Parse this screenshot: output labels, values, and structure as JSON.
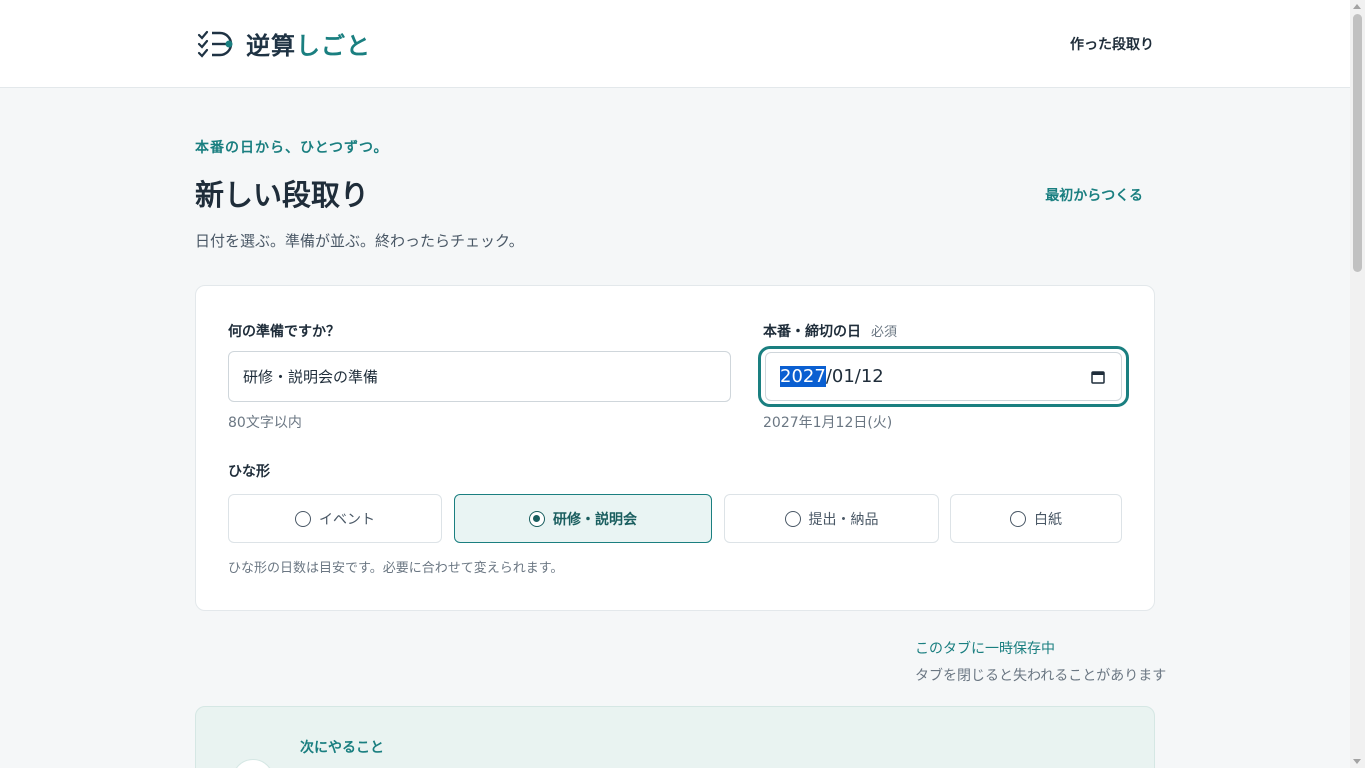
{
  "header": {
    "logo_text_dark": "逆算",
    "logo_text_teal": "しごと",
    "nav_link": "作った段取り"
  },
  "intro": {
    "eyebrow": "本番の日から、ひとつずつ。",
    "title": "新しい段取り",
    "restart_link": "最初からつくる",
    "subtitle": "日付を選ぶ。準備が並ぶ。終わったらチェック。"
  },
  "form": {
    "task_label": "何の準備ですか？",
    "task_value": "研修・説明会の準備",
    "task_hint": "80文字以内",
    "date_label": "本番・締切の日",
    "date_required": "必須",
    "date_year": "2027",
    "date_rest": "/01/12",
    "date_display": "2027年1月12日(火)",
    "template_label": "ひな形",
    "templates": [
      {
        "label": "イベント",
        "selected": false
      },
      {
        "label": "研修・説明会",
        "selected": true
      },
      {
        "label": "提出・納品",
        "selected": false
      },
      {
        "label": "白紙",
        "selected": false
      }
    ],
    "template_hint": "ひな形の日数は目安です。必要に合わせて変えられます。"
  },
  "save": {
    "status": "このタブに一時保存中",
    "note": "タブを閉じると失われることがあります"
  },
  "next": {
    "title": "次にやること"
  },
  "colors": {
    "accent": "#1a7f80",
    "background": "#f5f7f8",
    "selection": "#0a5fd1"
  }
}
